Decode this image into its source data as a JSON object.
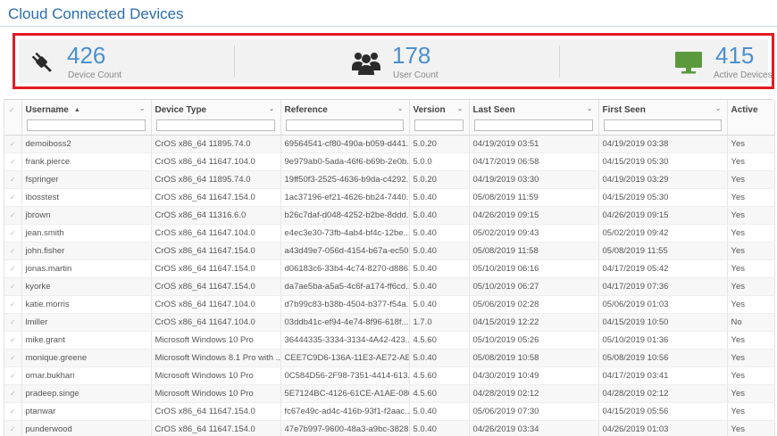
{
  "page": {
    "title": "Cloud Connected Devices"
  },
  "stats": [
    {
      "value": "426",
      "label": "Device Count",
      "icon": "plug-icon"
    },
    {
      "value": "178",
      "label": "User Count",
      "icon": "users-icon"
    },
    {
      "value": "415",
      "label": "Active Devices",
      "icon": "monitor-icon"
    }
  ],
  "colors": {
    "accent": "#4a90d0",
    "title": "#2a6db0",
    "highlight": "#e31b23",
    "monitor": "#5a9a3c"
  },
  "table": {
    "columns": [
      "Username",
      "Device Type",
      "Reference",
      "Version",
      "Last Seen",
      "First Seen",
      "Active"
    ],
    "rows": [
      [
        "demoiboss2",
        "CrOS x86_64 11895.74.0",
        "69564541-cf80-490a-b059-d441...",
        "5.0.20",
        "04/19/2019 03:51",
        "04/19/2019 03:38",
        "Yes"
      ],
      [
        "frank.pierce",
        "CrOS x86_64 11647.104.0",
        "9e979ab0-5ada-46f6-b69b-2e0b...",
        "5.0.0",
        "04/17/2019 06:58",
        "04/15/2019 05:30",
        "Yes"
      ],
      [
        "fspringer",
        "CrOS x86_64 11895.74.0",
        "19ff50f3-2525-4636-b9da-c4292...",
        "5.0.20",
        "04/19/2019 03:30",
        "04/19/2019 03:29",
        "Yes"
      ],
      [
        "ibosstest",
        "CrOS x86_64 11647.154.0",
        "1ac37196-ef21-4626-bb24-7440...",
        "5.0.40",
        "05/08/2019 11:59",
        "04/15/2019 05:30",
        "Yes"
      ],
      [
        "jbrown",
        "CrOS x86_64 11316.6.0",
        "b26c7daf-d048-4252-b2be-8ddd...",
        "5.0.40",
        "04/26/2019 09:15",
        "04/26/2019 09:15",
        "Yes"
      ],
      [
        "jean.smith",
        "CrOS x86_64 11647.104.0",
        "e4ec3e30-73fb-4ab4-bf4c-12be...",
        "5.0.40",
        "05/02/2019 09:43",
        "05/02/2019 09:42",
        "Yes"
      ],
      [
        "john.fisher",
        "CrOS x86_64 11647.154.0",
        "a43d49e7-056d-4154-b67a-ec50...",
        "5.0.40",
        "05/08/2019 11:58",
        "05/08/2019 11:55",
        "Yes"
      ],
      [
        "jonas.martin",
        "CrOS x86_64 11647.154.0",
        "d06183c6-33b4-4c74-8270-d886...",
        "5.0.40",
        "05/10/2019 06:16",
        "04/17/2019 05:42",
        "Yes"
      ],
      [
        "kyorke",
        "CrOS x86_64 11647.154.0",
        "da7ae5ba-a5a5-4c6f-a174-ff6cd...",
        "5.0.40",
        "05/10/2019 06:27",
        "04/17/2019 07:36",
        "Yes"
      ],
      [
        "katie.morris",
        "CrOS x86_64 11647.104.0",
        "d7b99c83-b38b-4504-b377-f54a...",
        "5.0.40",
        "05/06/2019 02:28",
        "05/06/2019 01:03",
        "Yes"
      ],
      [
        "lmiller",
        "CrOS x86_64 11647.104.0",
        "03ddb41c-ef94-4e74-8f96-618f...",
        "1.7.0",
        "04/15/2019 12:22",
        "04/15/2019 10:50",
        "No"
      ],
      [
        "mike.grant",
        "Microsoft Windows 10 Pro",
        "36444335-3334-3134-4A42-423...",
        "4.5.60",
        "05/10/2019 05:26",
        "05/10/2019 01:36",
        "Yes"
      ],
      [
        "monique.greene",
        "Microsoft Windows 8.1 Pro with ...",
        "CEE7C9D6-136A-11E3-AE72-AE8...",
        "5.0.40",
        "05/08/2019 10:58",
        "05/08/2019 10:56",
        "Yes"
      ],
      [
        "omar.bukhari",
        "Microsoft Windows 10 Pro",
        "0C584D56-2F98-7351-4414-613...",
        "4.5.60",
        "04/30/2019 10:49",
        "04/17/2019 03:41",
        "Yes"
      ],
      [
        "pradeep.singe",
        "Microsoft Windows 10 Pro",
        "5E7124BC-4126-61CE-A1AE-080...",
        "4.5.60",
        "04/28/2019 02:12",
        "04/28/2019 02:12",
        "Yes"
      ],
      [
        "ptanwar",
        "CrOS x86_64 11647.154.0",
        "fc67e49c-ad4c-416b-93f1-f2aac...",
        "5.0.40",
        "05/06/2019 07:30",
        "04/15/2019 05:56",
        "Yes"
      ],
      [
        "punderwood",
        "CrOS x86_64 11647.154.0",
        "47e7b997-9600-48a3-a9bc-3828...",
        "5.0.40",
        "04/26/2019 03:34",
        "04/26/2019 01:03",
        "Yes"
      ]
    ]
  }
}
